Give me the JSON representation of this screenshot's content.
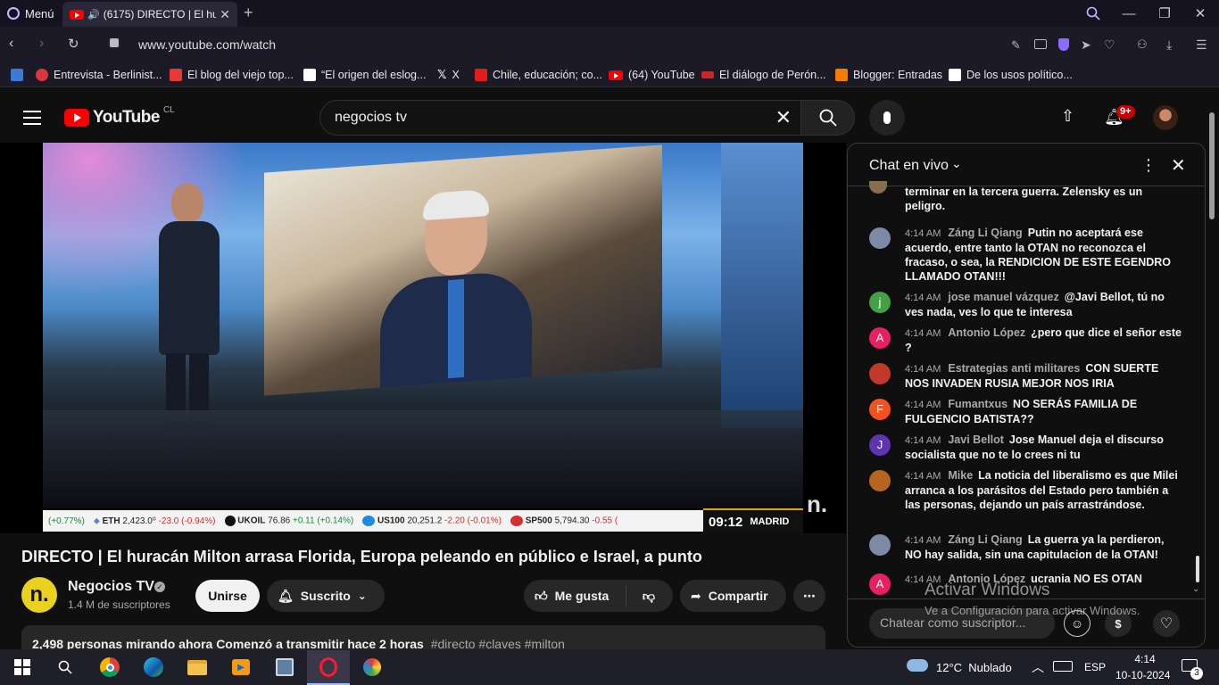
{
  "browser": {
    "menu_label": "Menú",
    "tab_title": "(6175) DIRECTO | El hur",
    "url": "www.youtube.com/watch",
    "bookmarks": [
      {
        "label": "",
        "color": "#3a7bd5"
      },
      {
        "label": "Entrevista - Berlinist...",
        "color": "#d9363e"
      },
      {
        "label": "El blog del viejo top...",
        "color": "#e53935"
      },
      {
        "label": "“El origen del eslog...",
        "color": "#ffffff"
      },
      {
        "label": "X",
        "color": "#000000"
      },
      {
        "label": "Chile, educación; co...",
        "color": "#e21b1b"
      },
      {
        "label": "(64) YouTube",
        "color": "#ff0000"
      },
      {
        "label": "El diálogo de Perón...",
        "color": "#c62828"
      },
      {
        "label": "Blogger: Entradas",
        "color": "#f57c00"
      },
      {
        "label": "De los usos político...",
        "color": "#ffffff"
      }
    ]
  },
  "youtube": {
    "logo": "YouTube",
    "country": "CL",
    "search_value": "negocios tv",
    "notifications": "9+"
  },
  "ticker": {
    "items": [
      {
        "text": "(+0.77%)"
      },
      {
        "sym": "ETH",
        "price": "2,423.0⁰",
        "chg": "-23.0 (-0.94%)"
      },
      {
        "sym": "UKOIL",
        "price": "76.86",
        "chg": "+0.11 (+0.14%)"
      },
      {
        "sym": "US100",
        "price": "20,251.2",
        "chg": "-2.20 (-0.01%)"
      },
      {
        "sym": "SP500",
        "price": "5,794.30",
        "chg": "-0.55 ("
      }
    ],
    "clock": "09:12",
    "city": "MADRID",
    "brand": "n."
  },
  "video": {
    "title": "DIRECTO | El huracán Milton arrasa Florida, Europa peleando en público e Israel, a punto",
    "channel": "Negocios TV",
    "subscribers": "1.4 M de suscriptores",
    "join": "Unirse",
    "subscribed": "Suscrito",
    "like": "Me gusta",
    "share": "Compartir",
    "desc_line": "2,498 personas mirando ahora  Comenzó a transmitir hace 2 horas",
    "hashtags": "#directo #claves #milton"
  },
  "chat": {
    "title": "Chat en vivo",
    "input_placeholder": "Chatear como suscriptor...",
    "messages": [
      {
        "time": "",
        "author": "",
        "text": "terminar en la tercera guerra. Zelensky es un peligro.",
        "avatar": "",
        "color": "#8a6d4a"
      },
      {
        "time": "4:14 AM",
        "author": "Záng Li Qiang",
        "text": "Putin no aceptará ese acuerdo, entre tanto la OTAN no reconozca el fracaso, o sea, la RENDICION DE ESTE EGENDRO LLAMADO OTAN!!!",
        "avatar": "",
        "color": "#7c8aa5"
      },
      {
        "time": "4:14 AM",
        "author": "jose manuel vázquez",
        "text": "@Javi Bellot, tú no ves nada, ves lo que te interesa",
        "avatar": "j",
        "color": "#43a047"
      },
      {
        "time": "4:14 AM",
        "author": "Antonio López",
        "text": "¿pero que dice el señor este ?",
        "avatar": "A",
        "color": "#e91e63"
      },
      {
        "time": "4:14 AM",
        "author": "Estrategias anti militares",
        "text": "CON SUERTE NOS INVADEN RUSIA MEJOR NOS IRIA",
        "avatar": "",
        "color": "#c0392b"
      },
      {
        "time": "4:14 AM",
        "author": "Fumantxus",
        "text": "NO SERÁS FAMILIA DE FULGENCIO BATISTA??",
        "avatar": "F",
        "color": "#f4511e"
      },
      {
        "time": "4:14 AM",
        "author": "Javi Bellot",
        "text": "Jose Manuel deja el discurso socialista que no te lo crees ni tu",
        "avatar": "J",
        "color": "#5e35b1"
      },
      {
        "time": "4:14 AM",
        "author": "Mike",
        "text": "La noticia del liberalismo es que Milei arranca a los parásitos del Estado pero también a las personas, dejando un país arrastrándose.",
        "avatar": "",
        "color": "#b5651d"
      },
      {
        "time": "4:14 AM",
        "author": "Záng Li Qiang",
        "text": "La guerra ya la perdieron, NO hay salida, sin una capitulacion de la OTAN!",
        "avatar": "",
        "color": "#7c8aa5"
      },
      {
        "time": "4:14 AM",
        "author": "Antonio López",
        "text": "ucrania NO ES OTAN",
        "avatar": "A",
        "color": "#e91e63"
      }
    ]
  },
  "watermark": {
    "line1": "Activar Windows",
    "line2": "Ve a Configuración para activar Windows."
  },
  "taskbar": {
    "weather": "12°C  Nublado",
    "lang": "ESP",
    "time": "4:14",
    "date": "10-10-2024",
    "notif_count": "3"
  }
}
